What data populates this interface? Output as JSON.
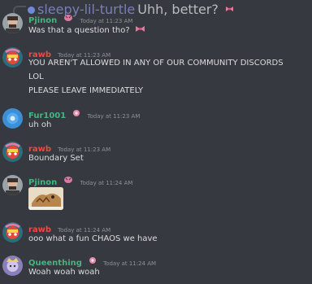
{
  "colors": {
    "background": "#36393f",
    "pjinon": "#43b581",
    "rawb": "#f04747",
    "fur1001": "#43b581",
    "queenthing": "#43b581",
    "reply_name": "#7b7fb3",
    "timestamp": "#8e9297",
    "text": "#dcddde"
  },
  "reply": {
    "username": "sleepy-lil-turtle",
    "content": "Uhh, better?",
    "badge_icon": "pink-bow-emoji-icon",
    "reply_icon": "reply-arrow-icon"
  },
  "messages": [
    {
      "username": "Pjinon",
      "badge_icon": "pink-tiger-emoji-icon",
      "timestamp": "Today at 11:23 AM",
      "lines": [
        "Was that a question tho?"
      ],
      "trailing_icon": "pink-bow-emoji-icon"
    },
    {
      "username": "rawb",
      "timestamp": "Today at 11:23 AM",
      "lines": [
        "YOU AREN'T ALLOWED IN ANY OF OUR COMMUNITY DISCORDS",
        "LOL",
        "PLEASE LEAVE IMMEDIATELY"
      ]
    },
    {
      "username": "Fur1001",
      "badge_icon": "pink-flower-emoji-icon",
      "timestamp": "Today at 11:23 AM",
      "lines": [
        "uh oh"
      ]
    },
    {
      "username": "rawb",
      "timestamp": "Today at 11:23 AM",
      "lines": [
        "Boundary Set"
      ]
    },
    {
      "username": "Pjinon",
      "badge_icon": "pink-tiger-emoji-icon",
      "timestamp": "Today at 11:24 AM",
      "attachment": "image-attachment"
    },
    {
      "username": "rawb",
      "timestamp": "Today at 11:24 AM",
      "lines": [
        "ooo what a fun CHAOS we have"
      ]
    },
    {
      "username": "Queenthing",
      "badge_icon": "pink-flower-emoji-icon",
      "timestamp": "Today at 11:24 AM",
      "lines": [
        "Woah woah woah"
      ]
    }
  ]
}
